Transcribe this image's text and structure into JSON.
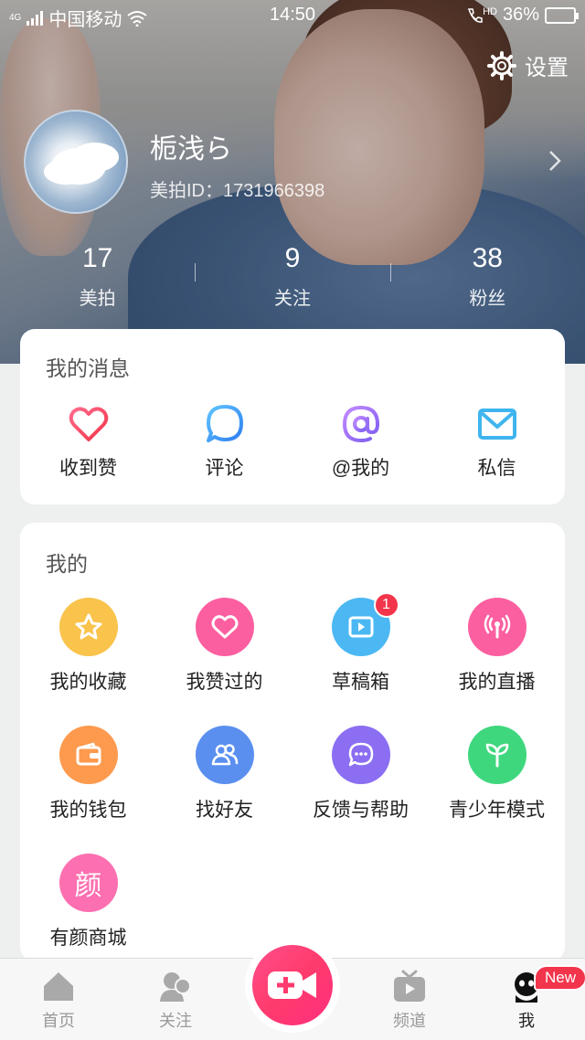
{
  "status": {
    "carrier": "中国移动",
    "network": "4G",
    "time": "14:50",
    "hd": "HD",
    "battery": "36%",
    "battery_level": 0.36
  },
  "header": {
    "settings_label": "设置",
    "username": "栀浅ら",
    "user_id": "美拍ID：1731966398",
    "stats": [
      {
        "num": "17",
        "label": "美拍"
      },
      {
        "num": "9",
        "label": "关注"
      },
      {
        "num": "38",
        "label": "粉丝"
      }
    ]
  },
  "messages": {
    "title": "我的消息",
    "items": [
      {
        "label": "收到赞",
        "icon": "heart-icon"
      },
      {
        "label": "评论",
        "icon": "comment-icon"
      },
      {
        "label": "@我的",
        "icon": "at-icon"
      },
      {
        "label": "私信",
        "icon": "mail-icon"
      }
    ]
  },
  "mine": {
    "title": "我的",
    "items": [
      {
        "label": "我的收藏",
        "icon": "star-icon",
        "color": "#f9c34c"
      },
      {
        "label": "我赞过的",
        "icon": "heart-icon",
        "color": "#fc5fa0"
      },
      {
        "label": "草稿箱",
        "icon": "play-icon",
        "color": "#4bb8f3",
        "badge": "1"
      },
      {
        "label": "我的直播",
        "icon": "broadcast-icon",
        "color": "#fc5fa0"
      },
      {
        "label": "我的钱包",
        "icon": "wallet-icon",
        "color": "#fd9a4e"
      },
      {
        "label": "找好友",
        "icon": "friends-icon",
        "color": "#5a8ff0"
      },
      {
        "label": "反馈与帮助",
        "icon": "chat-icon",
        "color": "#8b6ef2"
      },
      {
        "label": "青少年模式",
        "icon": "sprout-icon",
        "color": "#3fd77e"
      },
      {
        "label": "有颜商城",
        "icon": "yan-icon",
        "color": "#fc6fb0",
        "glyph": "颜"
      }
    ]
  },
  "tabbar": {
    "items": [
      {
        "label": "首页",
        "icon": "home-icon"
      },
      {
        "label": "关注",
        "icon": "follow-icon"
      },
      {
        "label": "频道",
        "icon": "tv-icon"
      },
      {
        "label": "我",
        "icon": "me-icon"
      }
    ],
    "new_badge": "New"
  }
}
